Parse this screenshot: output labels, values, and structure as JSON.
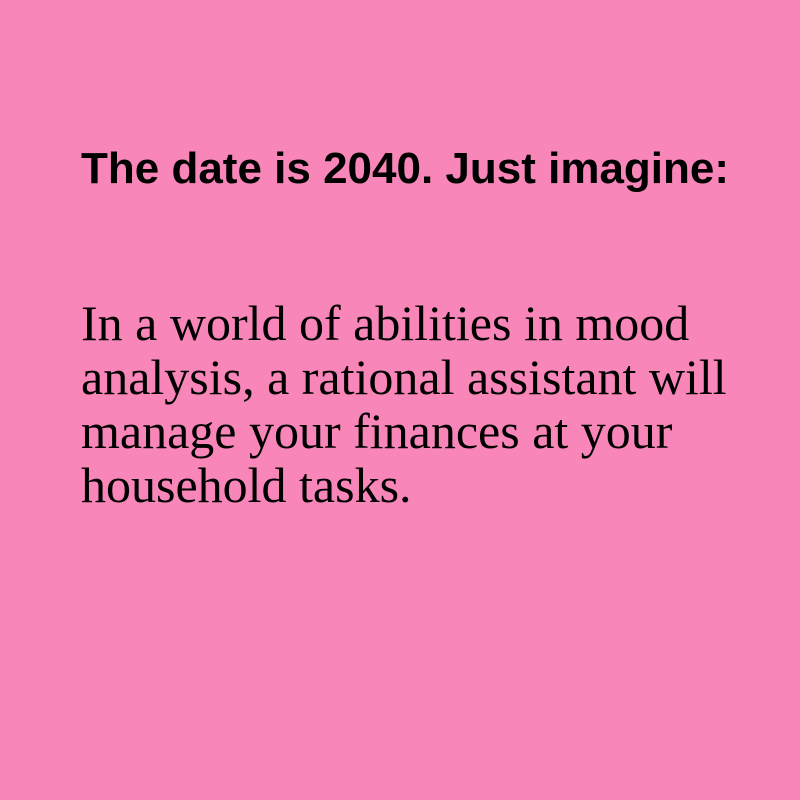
{
  "colors": {
    "background": "#f986b9",
    "text": "#000000"
  },
  "card": {
    "headline": "The date is 2040. Just imagine:",
    "body": "In a world of abilities in mood analysis, a rational assistant will manage your finances at your household tasks."
  }
}
